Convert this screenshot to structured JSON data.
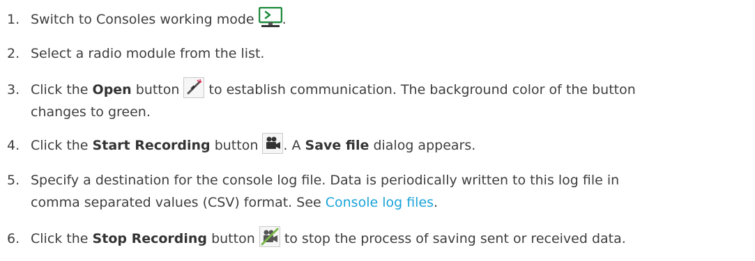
{
  "steps": [
    {
      "number": "1.",
      "before": "Switch to Consoles working mode",
      "after": "."
    },
    {
      "number": "2.",
      "text": "Select a radio module from the list."
    },
    {
      "number": "3.",
      "before": "Click the ",
      "bold": "Open",
      "middle": " button ",
      "after": " to establish communication. The background color of the button",
      "continuation": "changes to green."
    },
    {
      "number": "4.",
      "before": "Click the ",
      "bold": "Start Recording",
      "middle": " button ",
      "after": ". A ",
      "bold2": "Save file",
      "after2": " dialog appears."
    },
    {
      "number": "5.",
      "line1": "Specify a destination for the console log file. Data is periodically written to this log file in",
      "line2_before": "comma separated values (CSV) format. See ",
      "link": "Console log files",
      "line2_after": "."
    },
    {
      "number": "6.",
      "before": "Click the ",
      "bold": "Stop Recording",
      "middle": " button ",
      "after": " to stop the process of saving sent or received data."
    }
  ],
  "icons": {
    "consoles": "console-monitor-icon",
    "open": "plug-connect-icon",
    "start_recording": "video-camera-icon",
    "stop_recording": "camera-off-icon"
  },
  "colors": {
    "link": "#1aa3d9",
    "console_icon": "#1e8a3c"
  }
}
